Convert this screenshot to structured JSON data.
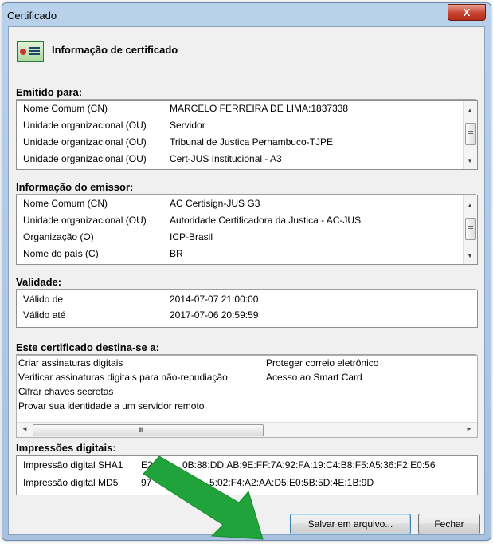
{
  "window": {
    "title": "Certificado",
    "close_label": "X"
  },
  "header": {
    "icon": "certificate-icon",
    "title": "Informação de certificado"
  },
  "issued_to": {
    "title": "Emitido para:",
    "rows": [
      {
        "label": "Nome Comum (CN)",
        "value": "MARCELO FERREIRA DE LIMA:1837338"
      },
      {
        "label": "Unidade organizacional (OU)",
        "value": "Servidor"
      },
      {
        "label": "Unidade organizacional (OU)",
        "value": "Tribunal de Justica Pernambuco-TJPE"
      },
      {
        "label": "Unidade organizacional (OU)",
        "value": "Cert-JUS Institucional - A3"
      }
    ]
  },
  "issuer": {
    "title": "Informação do emissor:",
    "rows": [
      {
        "label": "Nome Comum (CN)",
        "value": "AC Certisign-JUS G3"
      },
      {
        "label": "Unidade organizacional (OU)",
        "value": "Autoridade Certificadora da Justica - AC-JUS"
      },
      {
        "label": "Organização (O)",
        "value": "ICP-Brasil"
      },
      {
        "label": "Nome do país (C)",
        "value": "BR"
      }
    ]
  },
  "validity": {
    "title": "Validade:",
    "rows": [
      {
        "label": "Válido de",
        "value": "2014-07-07 21:00:00"
      },
      {
        "label": "Válido até",
        "value": "2017-07-06 20:59:59"
      }
    ]
  },
  "purposes": {
    "title": "Este certificado destina-se a:",
    "col1": [
      "Criar assinaturas digitais",
      "Verificar assinaturas digitais para não-repudiação",
      "Cifrar chaves secretas",
      "Provar sua identidade a um servidor remoto"
    ],
    "col2": [
      "Proteger correio eletrônico",
      "Acesso ao Smart Card"
    ],
    "scroll_grip": "III"
  },
  "fingerprints": {
    "title": "Impressões digitais:",
    "rows": [
      {
        "label": "Impressão digital SHA1",
        "value": "E2:0",
        "value2": "0B:88:DD:AB:9E:FF:7A:92:FA:19:C4:B8:F5:A5:36:F2:E0:56"
      },
      {
        "label": "Impressão digital MD5",
        "value": "97",
        "value2": "5:02:F4:A2:AA:D5:E0:5B:5D:4E:1B:9D"
      }
    ]
  },
  "buttons": {
    "save": "Salvar em arquivo...",
    "close": "Fechar"
  },
  "colors": {
    "arrow": "#1fa33a",
    "titlebar": "#b9d1ea",
    "close_button": "#c7432f"
  }
}
